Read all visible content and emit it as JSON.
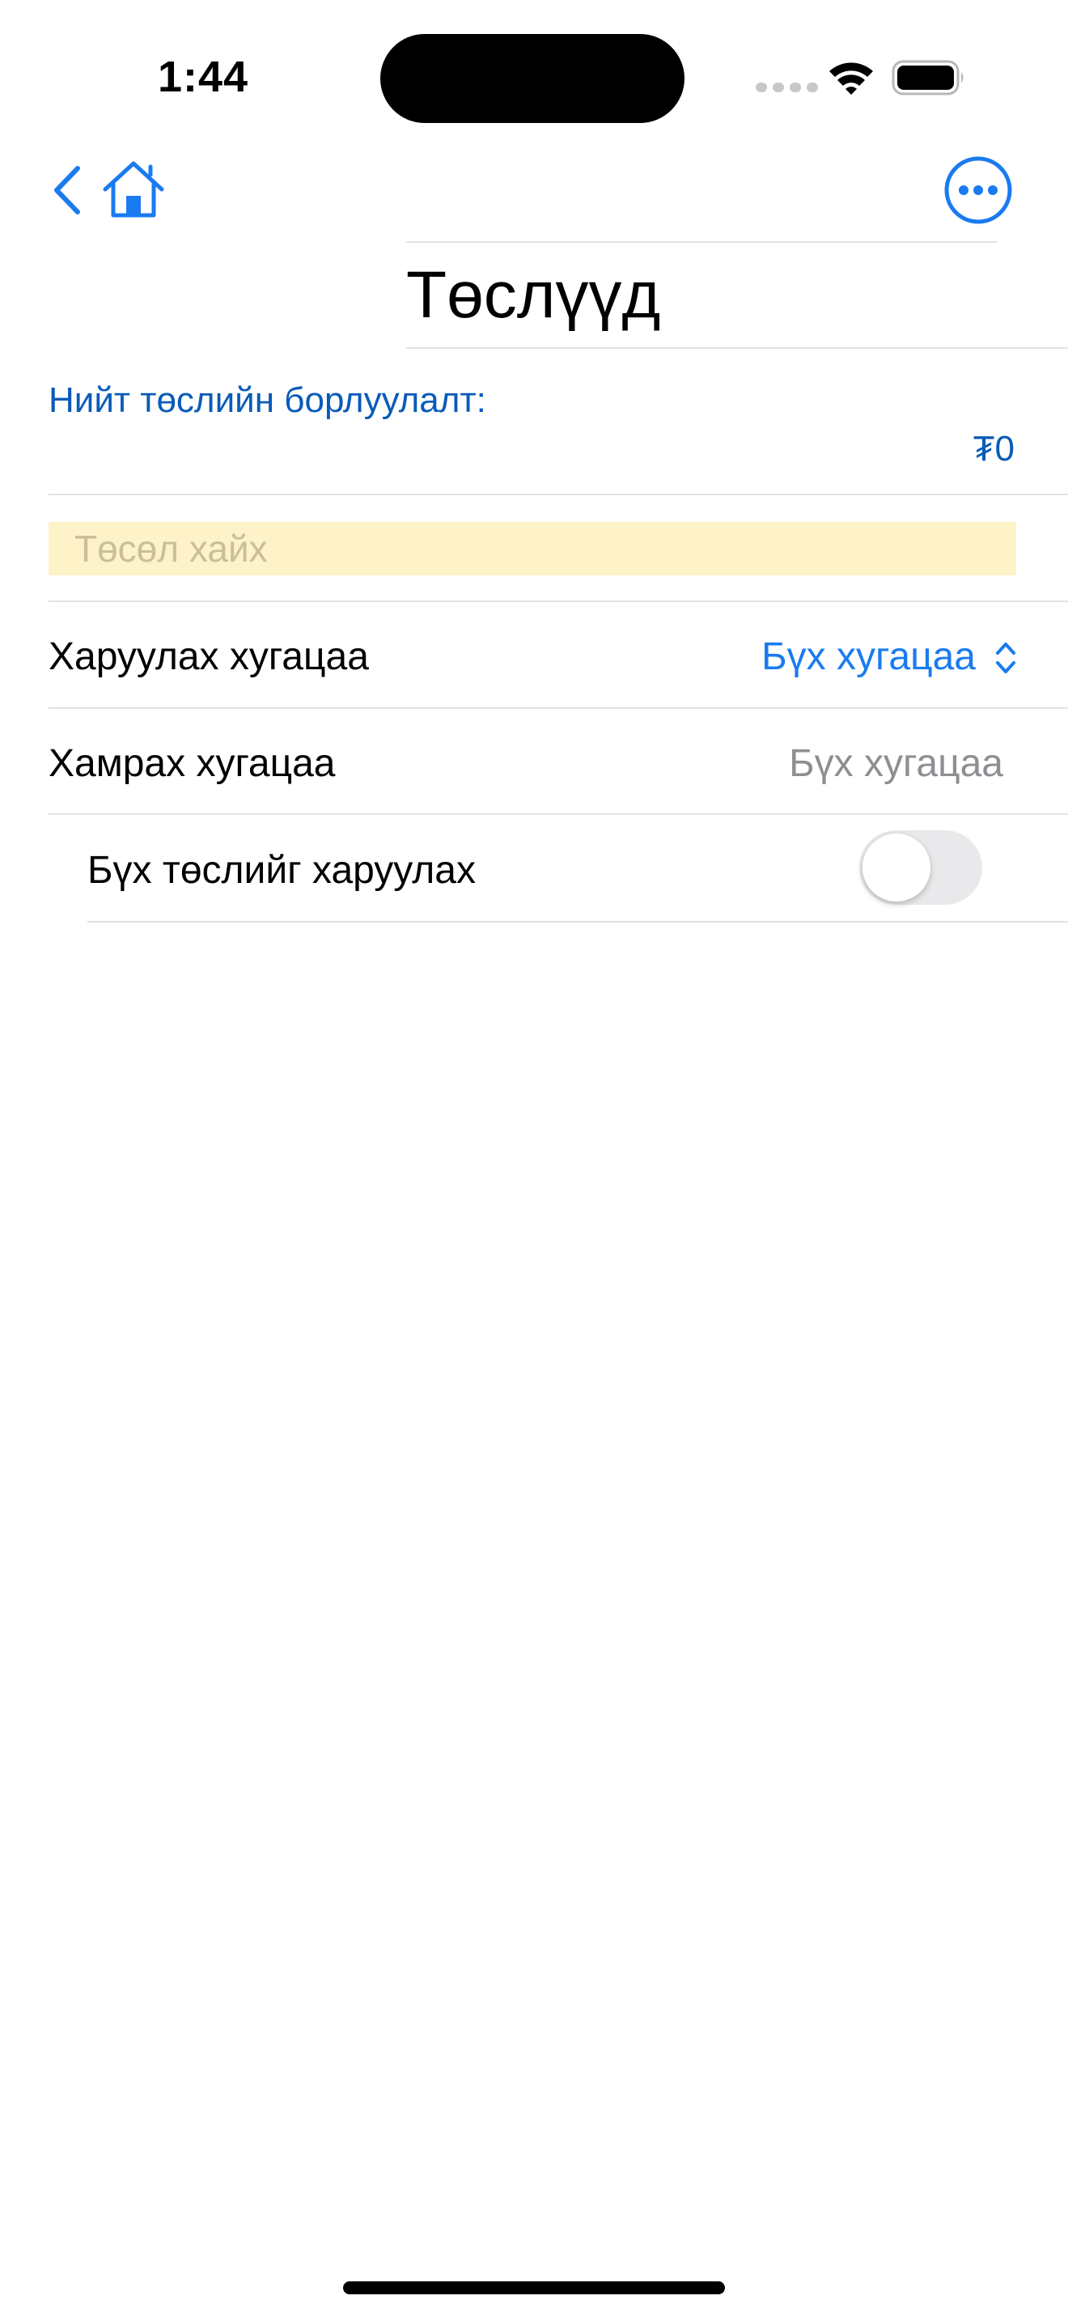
{
  "status_bar": {
    "time": "1:44"
  },
  "navigation": {
    "back_icon": "chevron-left-icon",
    "home_icon": "house-icon",
    "more_icon": "ellipsis-circle-icon",
    "accent_color": "#1a7bf0"
  },
  "page": {
    "title": "Төслүүд"
  },
  "summary": {
    "total_sales_label": "Нийт төслийн борлуулалт:",
    "total_sales_value": "₮0"
  },
  "search": {
    "placeholder": "Төсөл хайх",
    "value": "",
    "background": "#fdf2c8"
  },
  "filters": {
    "display_period_label": "Харуулах хугацаа",
    "display_period_value": "Бүх хугацаа",
    "coverage_period_label": "Хамрах хугацаа",
    "coverage_period_value": "Бүх хугацаа",
    "show_all_label": "Бүх төслийг харуулах",
    "show_all_enabled": false
  }
}
